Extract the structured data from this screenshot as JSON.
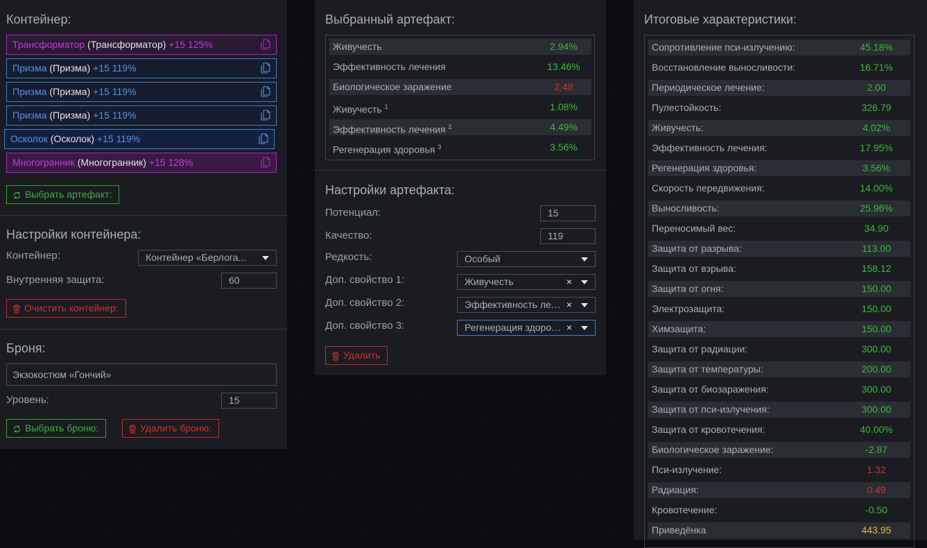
{
  "left": {
    "container_title": "Контейнер:",
    "artifacts": [
      {
        "name": "Трансформатор",
        "base": "(Трансформатор)",
        "level": "+15 125%"
      },
      {
        "name": "Призма",
        "base": "(Призма)",
        "level": "+15 119%"
      },
      {
        "name": "Призма",
        "base": "(Призма)",
        "level": "+15 119%"
      },
      {
        "name": "Призма",
        "base": "(Призма)",
        "level": "+15 119%"
      },
      {
        "name": "Осколок",
        "base": "(Осколок)",
        "level": "+15 119%"
      },
      {
        "name": "Многогранник",
        "base": "(Многогранник)",
        "level": "+15 128%"
      }
    ],
    "choose_artifact": "Выбрать артефакт:",
    "settings_title": "Настройки контейнера:",
    "container_label": "Контейнер:",
    "container_value": "Контейнер «Берлога...",
    "inner_protection_label": "Внутренняя защита:",
    "inner_protection_value": "60",
    "clear_container": "Очистить контейнер:",
    "armor_title": "Броня:",
    "armor_value": "Экзокостюм «Гончий»",
    "level_label": "Уровень:",
    "level_value": "15",
    "choose_armor": "Выбрать броню:",
    "delete_armor": "Удалить броню:"
  },
  "middle": {
    "selected_title": "Выбранный артефакт:",
    "stats": [
      {
        "name": "Живучесть",
        "sup": "",
        "value": "2.94%",
        "color": "green"
      },
      {
        "name": "Эффективность лечения",
        "sup": "",
        "value": "13.46%",
        "color": "green"
      },
      {
        "name": "Биологическое заражение",
        "sup": "",
        "value": "2.48",
        "color": "red"
      },
      {
        "name": "Живучесть",
        "sup": "1",
        "value": "1.08%",
        "color": "green"
      },
      {
        "name": "Эффективность лечения",
        "sup": "2",
        "value": "4.49%",
        "color": "green"
      },
      {
        "name": "Регенерация здоровья",
        "sup": "3",
        "value": "3.56%",
        "color": "green"
      }
    ],
    "settings_title": "Настройки артефакта:",
    "potential_label": "Потенциал:",
    "potential_value": "15",
    "quality_label": "Качество:",
    "quality_value": "119",
    "rarity_label": "Редкость:",
    "rarity_value": "Особый",
    "prop1_label": "Доп. свойство 1:",
    "prop1_value": "Живучесть",
    "prop2_label": "Доп. свойство 2:",
    "prop2_value": "Эффективность лечения",
    "prop3_label": "Доп. свойство 3:",
    "prop3_value": "Регенерация здоровья",
    "clear_symbol": "×",
    "delete": "Удалить"
  },
  "right": {
    "title": "Итоговые характеристики:",
    "stats": [
      {
        "name": "Сопротивление пси-излучению:",
        "value": "45.18%",
        "color": "green"
      },
      {
        "name": "Восстановление выносливости:",
        "value": "16.71%",
        "color": "green"
      },
      {
        "name": "Периодическое лечение:",
        "value": "2.00",
        "color": "green"
      },
      {
        "name": "Пулестойкость:",
        "value": "326.79",
        "color": "green"
      },
      {
        "name": "Живучесть:",
        "value": "4.02%",
        "color": "green"
      },
      {
        "name": "Эффективность лечения:",
        "value": "17.95%",
        "color": "green"
      },
      {
        "name": "Регенерация здоровья:",
        "value": "3.56%",
        "color": "green"
      },
      {
        "name": "Скорость передвижения:",
        "value": "14.00%",
        "color": "green"
      },
      {
        "name": "Выносливость:",
        "value": "25.96%",
        "color": "green"
      },
      {
        "name": "Переносимый вес:",
        "value": "34.90",
        "color": "green"
      },
      {
        "name": "Защита от разрыва:",
        "value": "113.00",
        "color": "green"
      },
      {
        "name": "Защита от взрыва:",
        "value": "158.12",
        "color": "green"
      },
      {
        "name": "Защита от огня:",
        "value": "150.00",
        "color": "green"
      },
      {
        "name": "Электрозащита:",
        "value": "150.00",
        "color": "green"
      },
      {
        "name": "Химзащита:",
        "value": "150.00",
        "color": "green"
      },
      {
        "name": "Защита от радиации:",
        "value": "300.00",
        "color": "green"
      },
      {
        "name": "Защита от температуры:",
        "value": "200.00",
        "color": "green"
      },
      {
        "name": "Защита от биозаражения:",
        "value": "300.00",
        "color": "green"
      },
      {
        "name": "Защита от пси-излучения:",
        "value": "300.00",
        "color": "green"
      },
      {
        "name": "Защита от кровотечения:",
        "value": "40.00%",
        "color": "green"
      },
      {
        "name": "Биологическое заражение:",
        "value": "-2.87",
        "color": "green"
      },
      {
        "name": "Пси-излучение:",
        "value": "1.32",
        "color": "red"
      },
      {
        "name": "Радиация:",
        "value": "0.49",
        "color": "red"
      },
      {
        "name": "Кровотечение:",
        "value": "-0.50",
        "color": "green"
      },
      {
        "name": "Приведёнка",
        "value": "443.95",
        "color": "gold"
      }
    ]
  }
}
